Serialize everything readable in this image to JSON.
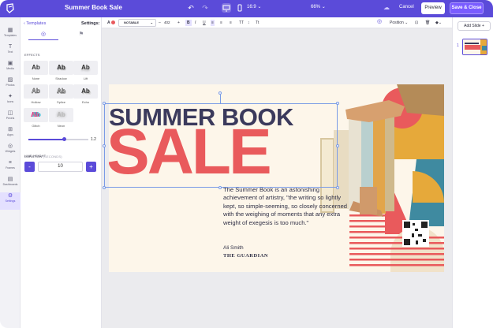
{
  "header": {
    "doc_title": "Summer Book Sale",
    "aspect_ratio": "16:9",
    "zoom": "66%",
    "cancel_label": "Cancel",
    "preview_label": "Preview",
    "save_label": "Save & Close"
  },
  "rail": {
    "items": [
      {
        "label": "Templates",
        "icon": "templates-icon"
      },
      {
        "label": "Text",
        "icon": "text-icon"
      },
      {
        "label": "Media",
        "icon": "media-icon"
      },
      {
        "label": "Photos",
        "icon": "photos-icon"
      },
      {
        "label": "Icons",
        "icon": "icons-icon"
      },
      {
        "label": "Pexels",
        "icon": "pexels-icon"
      },
      {
        "label": "Apps",
        "icon": "apps-icon"
      },
      {
        "label": "Widgets",
        "icon": "widgets-icon"
      },
      {
        "label": "Frames",
        "icon": "frames-icon"
      },
      {
        "label": "Dashboards",
        "icon": "dashboards-icon"
      },
      {
        "label": "Settings",
        "icon": "settings-icon"
      }
    ]
  },
  "panel": {
    "back_label": "Templates",
    "title": "Settings:",
    "effects_label": "EFFECTS",
    "effects": [
      {
        "sample": "Ab",
        "label": "None"
      },
      {
        "sample": "Ab",
        "label": "Shadow"
      },
      {
        "sample": "Ab",
        "label": "Lift"
      },
      {
        "sample": "Ab",
        "label": "Hollow"
      },
      {
        "sample": "Ab",
        "label": "Splice"
      },
      {
        "sample": "Ab",
        "label": "Echo"
      },
      {
        "sample": "Ab",
        "label": "Glitch"
      },
      {
        "sample": "Ab",
        "label": "Neon"
      }
    ],
    "line_height_label": "LINE HEIGHT",
    "line_height_value": "1.2",
    "line_height_fraction": 0.6,
    "duration_label": "DURATION",
    "duration_unit": "(SECONDS)",
    "duration_value": "10",
    "minus": "-",
    "plus": "+"
  },
  "toolbar": {
    "font_name": "NOTABLE",
    "font_size": "402",
    "text_color": "#e85a5e",
    "position_label": "Position"
  },
  "slides": {
    "add_label": "Add Slide",
    "slide_number": "1"
  },
  "design": {
    "headline_top": "SUMMER BOOK",
    "headline_big": "SALE",
    "body": "The Summer Book is an astonishing achievement of artistry, \"the writing so lightly kept, so simple-seeming, so closely concerned with the weighing of moments that any extra weight of exegesis is too much.\"",
    "author": "Ali Smith",
    "publication": "THE GUARDIAN",
    "colors": {
      "coral": "#e95a5c",
      "navy": "#3b3a5c",
      "mustard": "#e6a93a",
      "teal": "#3f8aa0",
      "cream": "#fdf6ea"
    }
  }
}
